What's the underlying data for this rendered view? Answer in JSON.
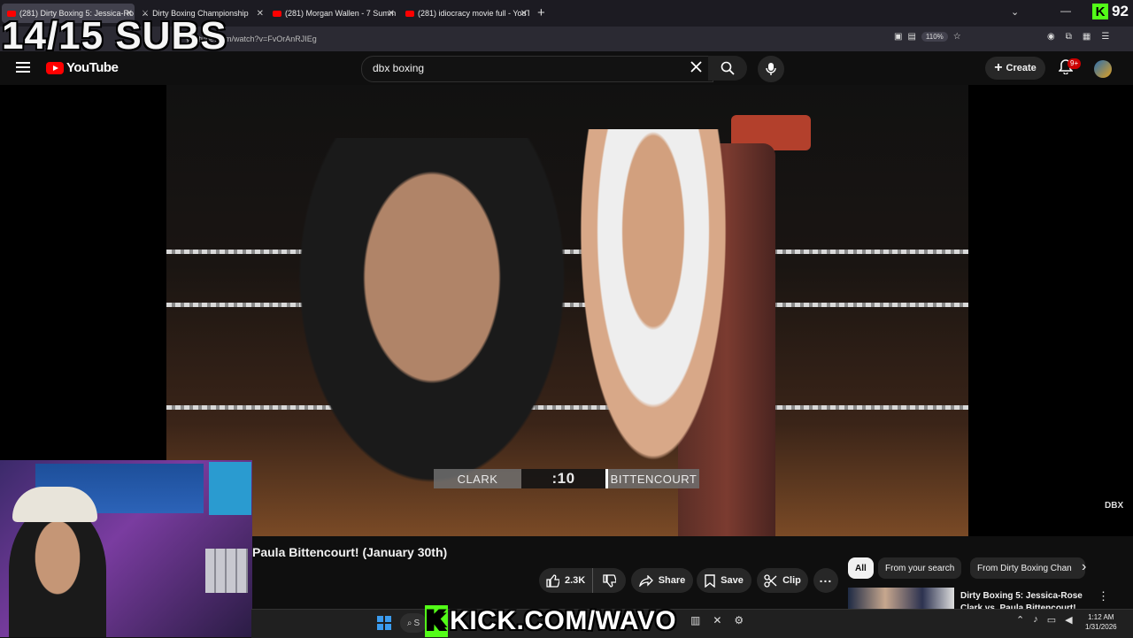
{
  "browser": {
    "tabs": [
      {
        "label": "(281) Dirty Boxing 5: Jessica-Ro",
        "active": true
      },
      {
        "label": "Dirty Boxing Championship"
      },
      {
        "label": "(281) Morgan Wallen - 7 Summ"
      },
      {
        "label": "(281) idiocracy movie full - YouT"
      }
    ],
    "new_tab": "+",
    "url": "youtube.com/watch?v=FvOrAnRJIEg",
    "zoom": "110%"
  },
  "overlay": {
    "subs_text": "14/15 SUBS",
    "kick_count": "92",
    "kick_k": "K",
    "kick_url": "KICK.COM/WAVO"
  },
  "youtube": {
    "logo_text": "YouTube",
    "search_query": "dbx boxing",
    "create_label": "Create",
    "notification_count": "9+"
  },
  "video": {
    "scorebug": {
      "left_name": "CLARK",
      "clock": ":10",
      "right_name": "BITTENCOURT"
    },
    "watermark": "DBX",
    "title": "Paula Bittencourt! (January 30th)"
  },
  "actions": {
    "like_count": "2.3K",
    "share_label": "Share",
    "save_label": "Save",
    "clip_label": "Clip",
    "more_label": "..."
  },
  "chips": [
    {
      "label": "All",
      "selected": true
    },
    {
      "label": "From your search"
    },
    {
      "label": "From Dirty Boxing Chan"
    }
  ],
  "recommendation": {
    "title": "Dirty Boxing 5: Jessica-Rose Clark vs. Paula Bittencourt!"
  },
  "taskbar": {
    "search_label": "S",
    "clock_time": "1:12 AM",
    "clock_date": "1/31/2026"
  },
  "colors": {
    "youtube_red": "#ff0000",
    "kick_green": "#53fc18",
    "background": "#0f0f0f"
  },
  "icons": [
    "menu-icon",
    "search-icon",
    "mic-icon",
    "clear-icon",
    "bell-icon",
    "like-icon",
    "dislike-icon",
    "share-icon",
    "save-icon",
    "clip-icon",
    "more-icon",
    "windows-icon",
    "chevron-right-icon"
  ]
}
